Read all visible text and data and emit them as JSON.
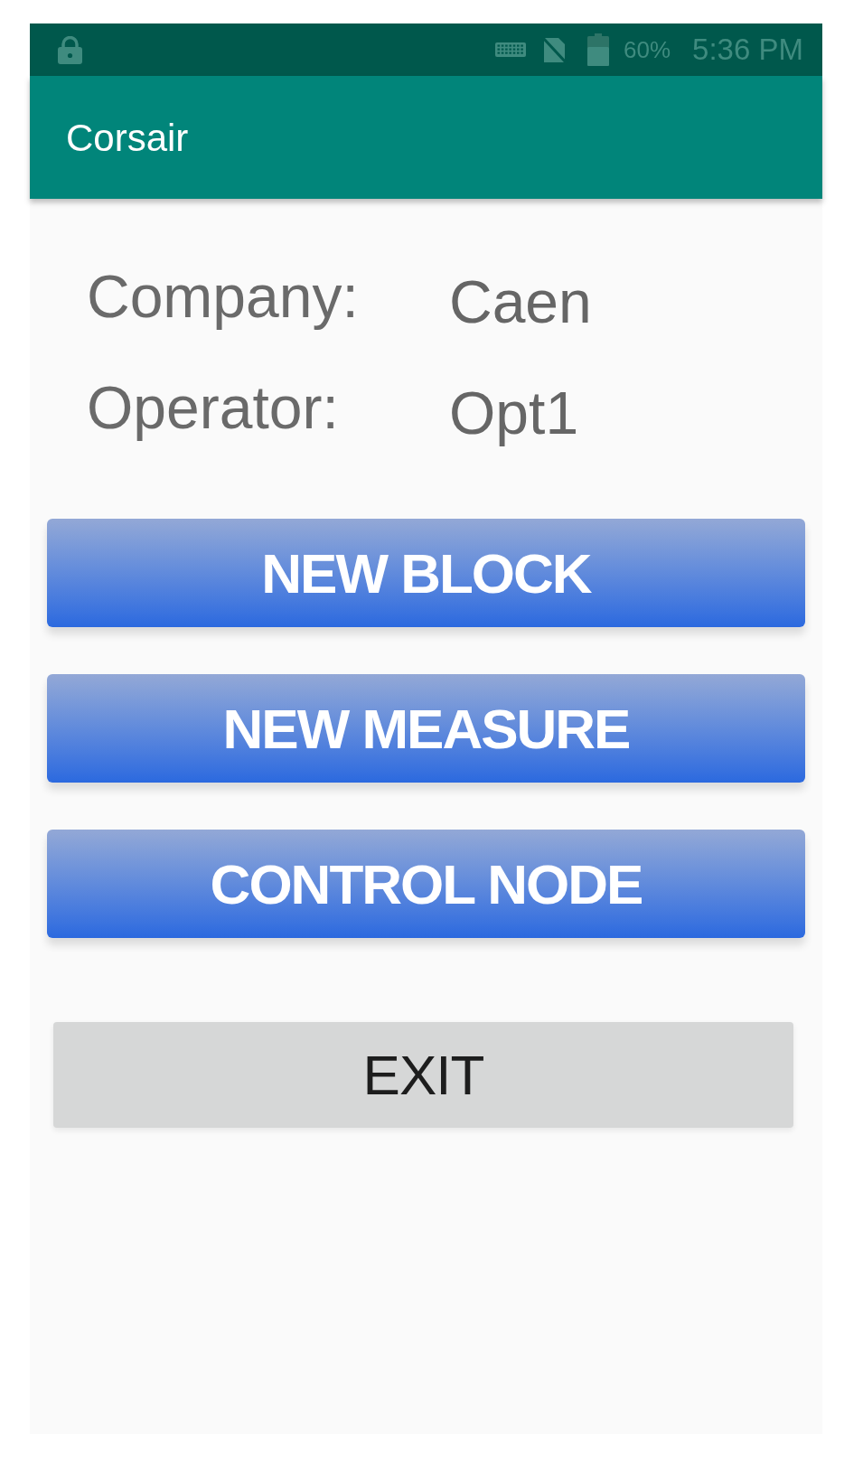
{
  "status_bar": {
    "battery": "60%",
    "time": "5:36 PM"
  },
  "app_bar": {
    "title": "Corsair"
  },
  "info": [
    {
      "label": "Company:",
      "value": "Caen"
    },
    {
      "label": "Operator:",
      "value": "Opt1"
    }
  ],
  "buttons": [
    {
      "label": "NEW BLOCK",
      "kind": "primary"
    },
    {
      "label": "NEW MEASURE",
      "kind": "primary"
    },
    {
      "label": "CONTROL NODE",
      "kind": "primary"
    },
    {
      "label": "EXIT",
      "kind": "secondary"
    }
  ]
}
